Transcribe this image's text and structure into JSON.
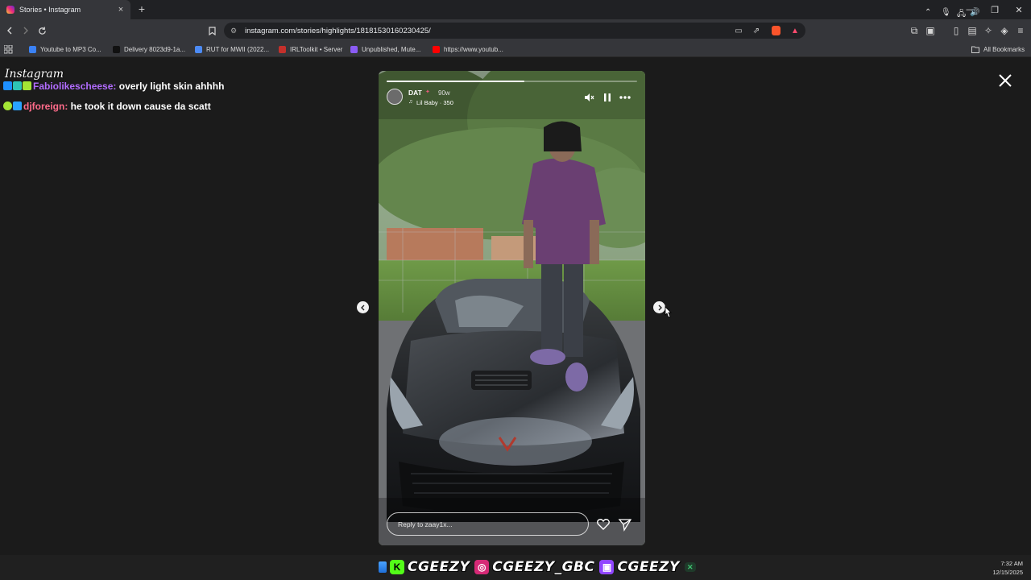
{
  "browser": {
    "tab": {
      "title": "Stories • Instagram",
      "close_glyph": "×"
    },
    "new_tab_glyph": "+",
    "window_controls": {
      "minimize": "—",
      "restore": "❐",
      "close": "✕"
    },
    "url": "instagram.com/stories/highlights/18181530160230425/",
    "bookmarks": [
      {
        "label": "Youtube to MP3 Co...",
        "icon_color": "#3b82f6"
      },
      {
        "label": "Delivery 8023d9-1a...",
        "icon_color": "#111111"
      },
      {
        "label": "RUT for MWII (2022...",
        "icon_color": "#4c8bf5"
      },
      {
        "label": "IRLToolkit • Server",
        "icon_color": "#c4302b"
      },
      {
        "label": "Unpublished, Mute...",
        "icon_color": "#8b5cf6"
      },
      {
        "label": "https://www.youtub...",
        "icon_color": "#ff0000"
      }
    ],
    "all_bookmarks": "All Bookmarks"
  },
  "overlay": {
    "instagram_wordmark": "Instagram",
    "chat": [
      {
        "user": "Fabiolikescheese",
        "user_color": "#b26cff",
        "message": "overly light skin ahhhh"
      },
      {
        "user": "djforeign",
        "user_color": "#ff6b8a",
        "message": "he took it down cause da scatt"
      }
    ]
  },
  "story": {
    "username": "DAT",
    "time": "90w",
    "music": "Lil Baby · 350",
    "reply_placeholder": "Reply to zaay1x...",
    "progress": 0.55
  },
  "stream_bar": {
    "handles": [
      {
        "platform": "kick-icon",
        "handle": "CGEEZY",
        "color": "#53fc18"
      },
      {
        "platform": "instagram-icon",
        "handle": "CGEEZY_GBC",
        "color": "#d62976"
      },
      {
        "platform": "twitch-icon",
        "handle": "CGEEZY",
        "color": "#9146ff"
      }
    ]
  },
  "taskbar": {
    "time": "7:32 AM",
    "date": "12/15/2025"
  }
}
